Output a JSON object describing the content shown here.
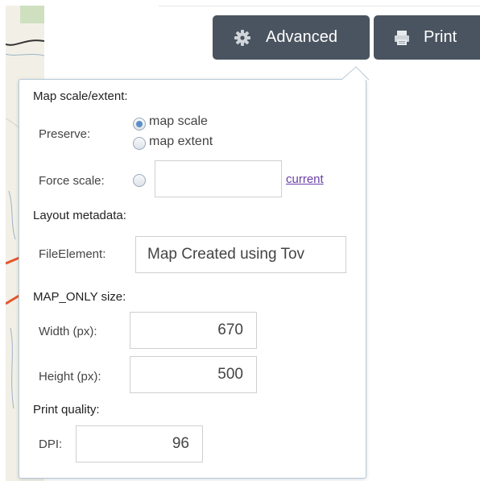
{
  "toolbar": {
    "advanced_label": "Advanced",
    "print_label": "Print",
    "button_color": "#4a5460"
  },
  "panel": {
    "map_scale_extent": {
      "title": "Map scale/extent:",
      "preserve_label": "Preserve:",
      "options": [
        {
          "label": "map scale",
          "checked": true
        },
        {
          "label": "map extent",
          "checked": false
        }
      ],
      "force_scale_label": "Force scale:",
      "force_scale_value": "",
      "current_link": "current"
    },
    "layout_metadata": {
      "title": "Layout metadata:",
      "file_element_label": "FileElement:",
      "file_element_value": "Map Created using Tov"
    },
    "map_only_size": {
      "title": "MAP_ONLY size:",
      "width_label": "Width (px):",
      "width_value": "670",
      "height_label": "Height (px):",
      "height_value": "500"
    },
    "print_quality": {
      "title": "Print quality:",
      "dpi_label": "DPI:",
      "dpi_value": "96"
    }
  },
  "colors": {
    "panel_border": "#b7c9d8",
    "radio_selected": "#5b8ec6",
    "link": "#6a3fa8"
  }
}
